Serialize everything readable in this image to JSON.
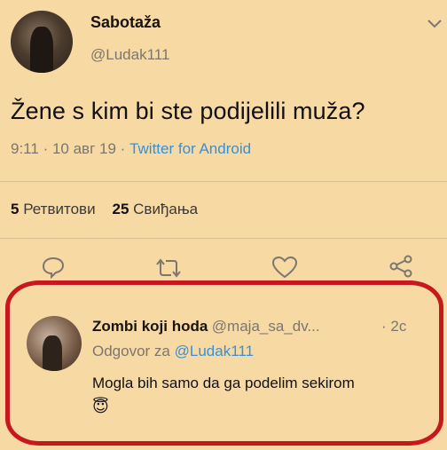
{
  "tweet": {
    "author_name": "Sabotaža",
    "author_handle": "@Ludak111",
    "text": "Žene s kim bi ste podijelili muža?",
    "time": "9:11",
    "sep1": "·",
    "date": "10 авг 19",
    "sep2": "·",
    "source": "Twitter for Android",
    "retweets_count": "5",
    "retweets_label": "Ретвитови",
    "likes_count": "25",
    "likes_label": "Свиђања"
  },
  "actions": {
    "reply_icon": "comment-icon",
    "retweet_icon": "retweet-icon",
    "like_icon": "heart-icon",
    "share_icon": "share-icon",
    "more_icon": "chevron-down-icon"
  },
  "reply": {
    "author_name": "Zombi koji hoda",
    "author_handle": "@maja_sa_dv...",
    "time_sep": "·",
    "time": "2c",
    "replying_prefix": "Odgovor za",
    "replying_to": "@Ludak111",
    "text": "Mogla bih samo da ga podelim sekirom",
    "emoji": "😇"
  },
  "colors": {
    "background": "#f6d9a3",
    "link": "#3b8fd6",
    "muted": "#7d766e",
    "highlight": "#c8171d"
  }
}
